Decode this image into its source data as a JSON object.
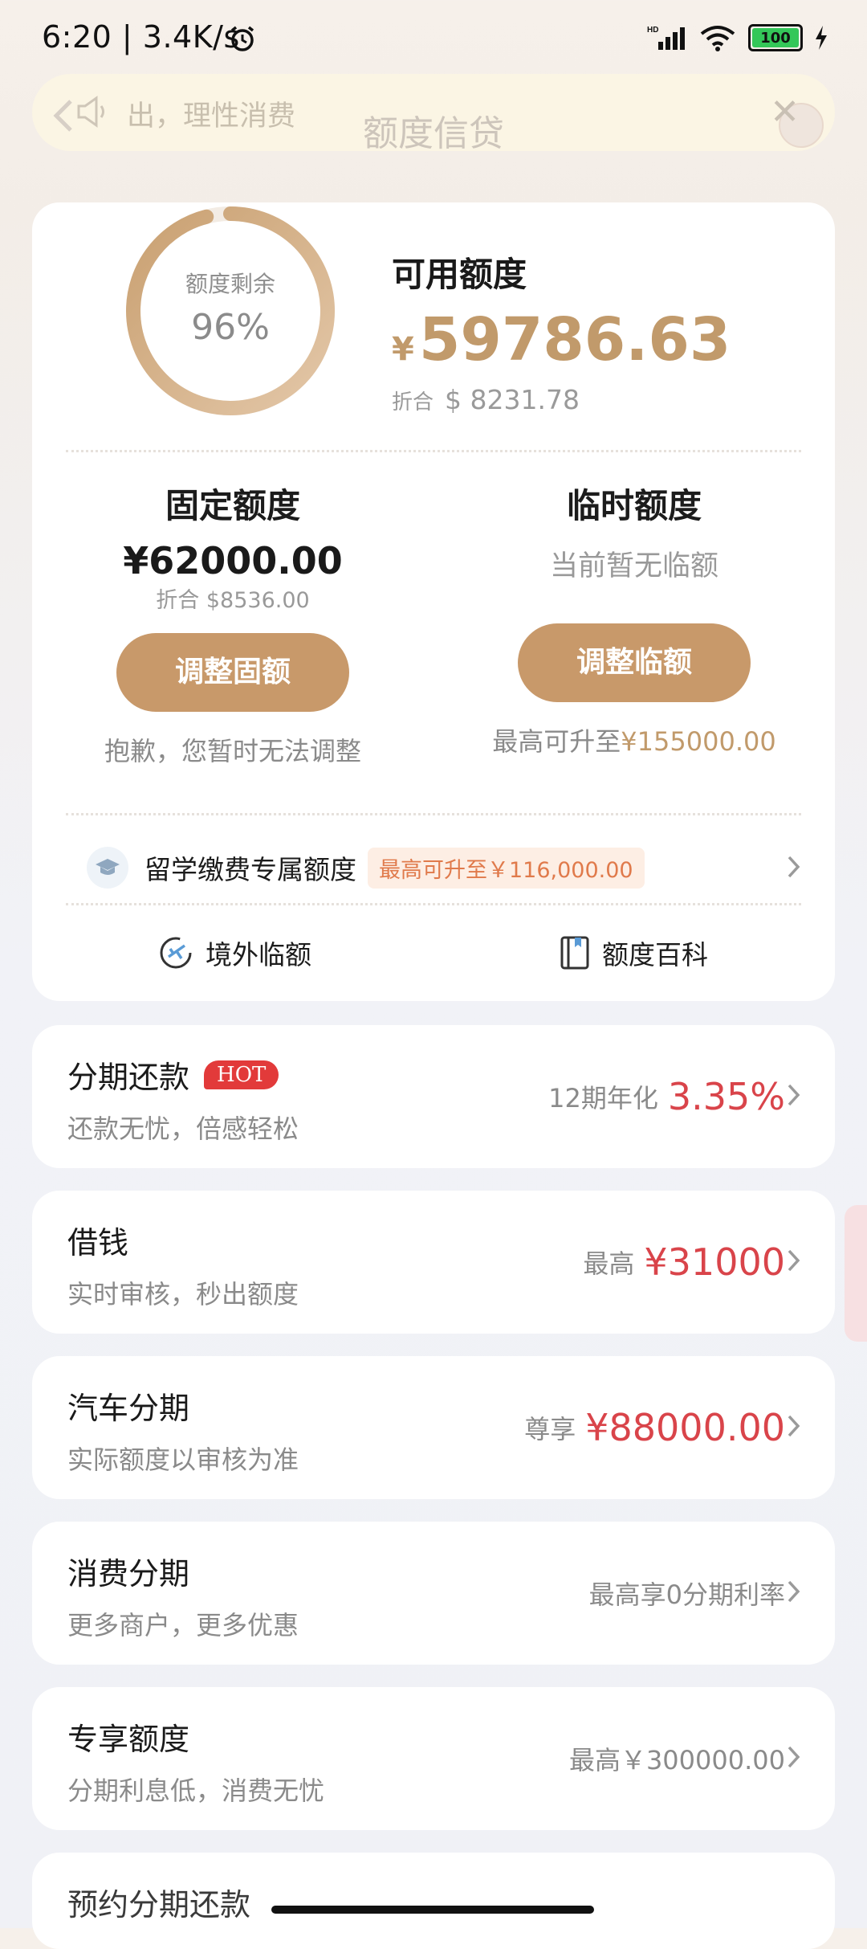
{
  "status_bar": {
    "time": "6:20 | 3.4K/s",
    "battery": "100"
  },
  "header": {
    "notice": "出，理性消费",
    "title": "额度信贷"
  },
  "summary": {
    "ring_label": "额度剩余",
    "ring_percent": "96%",
    "remaining_fraction": 0.96,
    "available_label": "可用额度",
    "currency_symbol": "¥",
    "available_amount": "59786.63",
    "conversion_prefix": "折合",
    "conversion_value": "$ 8231.78"
  },
  "fixed_limit": {
    "title": "固定额度",
    "amount": "¥62000.00",
    "conversion": "折合 $8536.00",
    "button": "调整固额",
    "note": "抱歉，您暂时无法调整"
  },
  "temp_limit": {
    "title": "临时额度",
    "status": "当前暂无临额",
    "button": "调整临额",
    "note_prefix": "最高可升至",
    "note_value": "¥155000.00"
  },
  "study_abroad": {
    "label": "留学缴费专属额度",
    "badge": "最高可升至￥116,000.00"
  },
  "links": {
    "overseas": "境外临额",
    "encyclopedia": "额度百科"
  },
  "items": [
    {
      "title": "分期还款",
      "badge": "HOT",
      "subtitle": "还款无忧，倍感轻松",
      "right_prefix": "12期年化",
      "right_value": "3.35%"
    },
    {
      "title": "借钱",
      "subtitle": "实时审核，秒出额度",
      "right_prefix": "最高",
      "right_value": "¥31000"
    },
    {
      "title": "汽车分期",
      "subtitle": "实际额度以审核为准",
      "right_prefix": "尊享",
      "right_value": "¥88000.00"
    },
    {
      "title": "消费分期",
      "subtitle": "更多商户，更多优惠",
      "right_text": "最高享0分期利率"
    },
    {
      "title": "专享额度",
      "subtitle": "分期利息低，消费无忧",
      "right_text": "最高￥300000.00"
    },
    {
      "title": "预约分期还款"
    }
  ],
  "colors": {
    "gold": "#c19a6b",
    "button": "#c8996a",
    "red": "#d9444a",
    "ring_start": "#e3c7a8",
    "ring_end": "#c9a071"
  }
}
